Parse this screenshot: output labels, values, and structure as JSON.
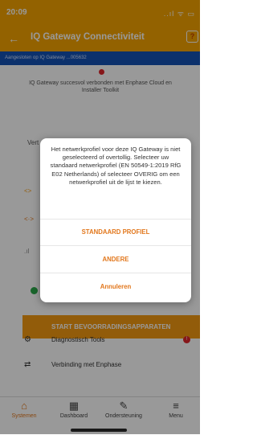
{
  "status_bar": {
    "time": "20:09",
    "icons": "..ıl ᯤ ▭"
  },
  "header": {
    "title": "IQ Gateway Connectiviteit",
    "help": "?"
  },
  "connected_bar": {
    "text": "Aangesloten op IQ Gateway ...005632"
  },
  "success": {
    "text": "IQ Gateway succesvol verbonden met Enphase Cloud en Installer Toolkit"
  },
  "background": {
    "vert_label": "Vert",
    "arrow": "<>",
    "arrow2": "<·>",
    "signal": ".ıl"
  },
  "start_button": {
    "label": "START BEVOORRADINGSAPPARATEN"
  },
  "list": [
    {
      "label": "Diagnostisch Tools",
      "icon": "⚙",
      "badge": "!"
    },
    {
      "label": "Verbinding met Enphase",
      "icon": "⇄"
    }
  ],
  "dialog": {
    "message": "Het netwerkprofiel voor deze IQ Gateway is niet geselecteerd of overtollig. Selecteer uw standaard netwerkprofiel (EN 50549-1:2019 RfG E02 Netherlands) of selecteer OVERIG om een netwerkprofiel uit de lijst te kiezen.",
    "buttons": {
      "standard": "STANDAARD PROFIEL",
      "other": "ANDERE",
      "cancel": "Annuleren"
    }
  },
  "bottom_nav": [
    {
      "label": "Systemen",
      "icon": "⌂"
    },
    {
      "label": "Dashboard",
      "icon": "▦"
    },
    {
      "label": "Ondersteuning",
      "icon": "✎"
    },
    {
      "label": "Menu",
      "icon": "≡"
    }
  ],
  "colors": {
    "accent": "#f5a400",
    "brand_blue": "#1452b4",
    "action_orange": "#e2771c"
  }
}
